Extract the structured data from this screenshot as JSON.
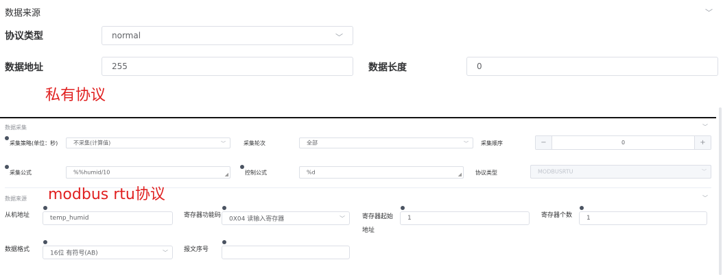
{
  "top": {
    "section_title": "数据来源",
    "protocol_type_label": "协议类型",
    "protocol_type_value": "normal",
    "data_addr_label": "数据地址",
    "data_addr_value": "255",
    "data_len_label": "数据长度",
    "data_len_value": "0"
  },
  "annotations": {
    "private": "私有协议",
    "modbus": "modbus rtu协议"
  },
  "collect": {
    "section_title": "数据采集",
    "strategy_label": "采集策略(单位：秒)",
    "strategy_value": "不采集(计算值)",
    "rounds_label": "采集轮次",
    "rounds_value": "全部",
    "order_label": "采集顺序",
    "order_value": "0",
    "order_minus": "−",
    "order_plus": "+",
    "formula_label": "采集公式",
    "formula_value": "%%humid/10",
    "control_label": "控制公式",
    "control_value": "%d",
    "protocol_label": "协议类型",
    "protocol_value": "MODBUSRTU"
  },
  "source": {
    "section_title": "数据来源",
    "slave_label": "从机地址",
    "slave_value": "temp_humid",
    "func_label": "寄存器功能码",
    "func_value": "0X04 读输入寄存器",
    "start_label": "寄存器起始地址",
    "start_value": "1",
    "count_label": "寄存器个数",
    "count_value": "1",
    "format_label": "数据格式",
    "format_value": "16位 有符号(AB)",
    "seq_label": "报文序号",
    "seq_value": ""
  }
}
